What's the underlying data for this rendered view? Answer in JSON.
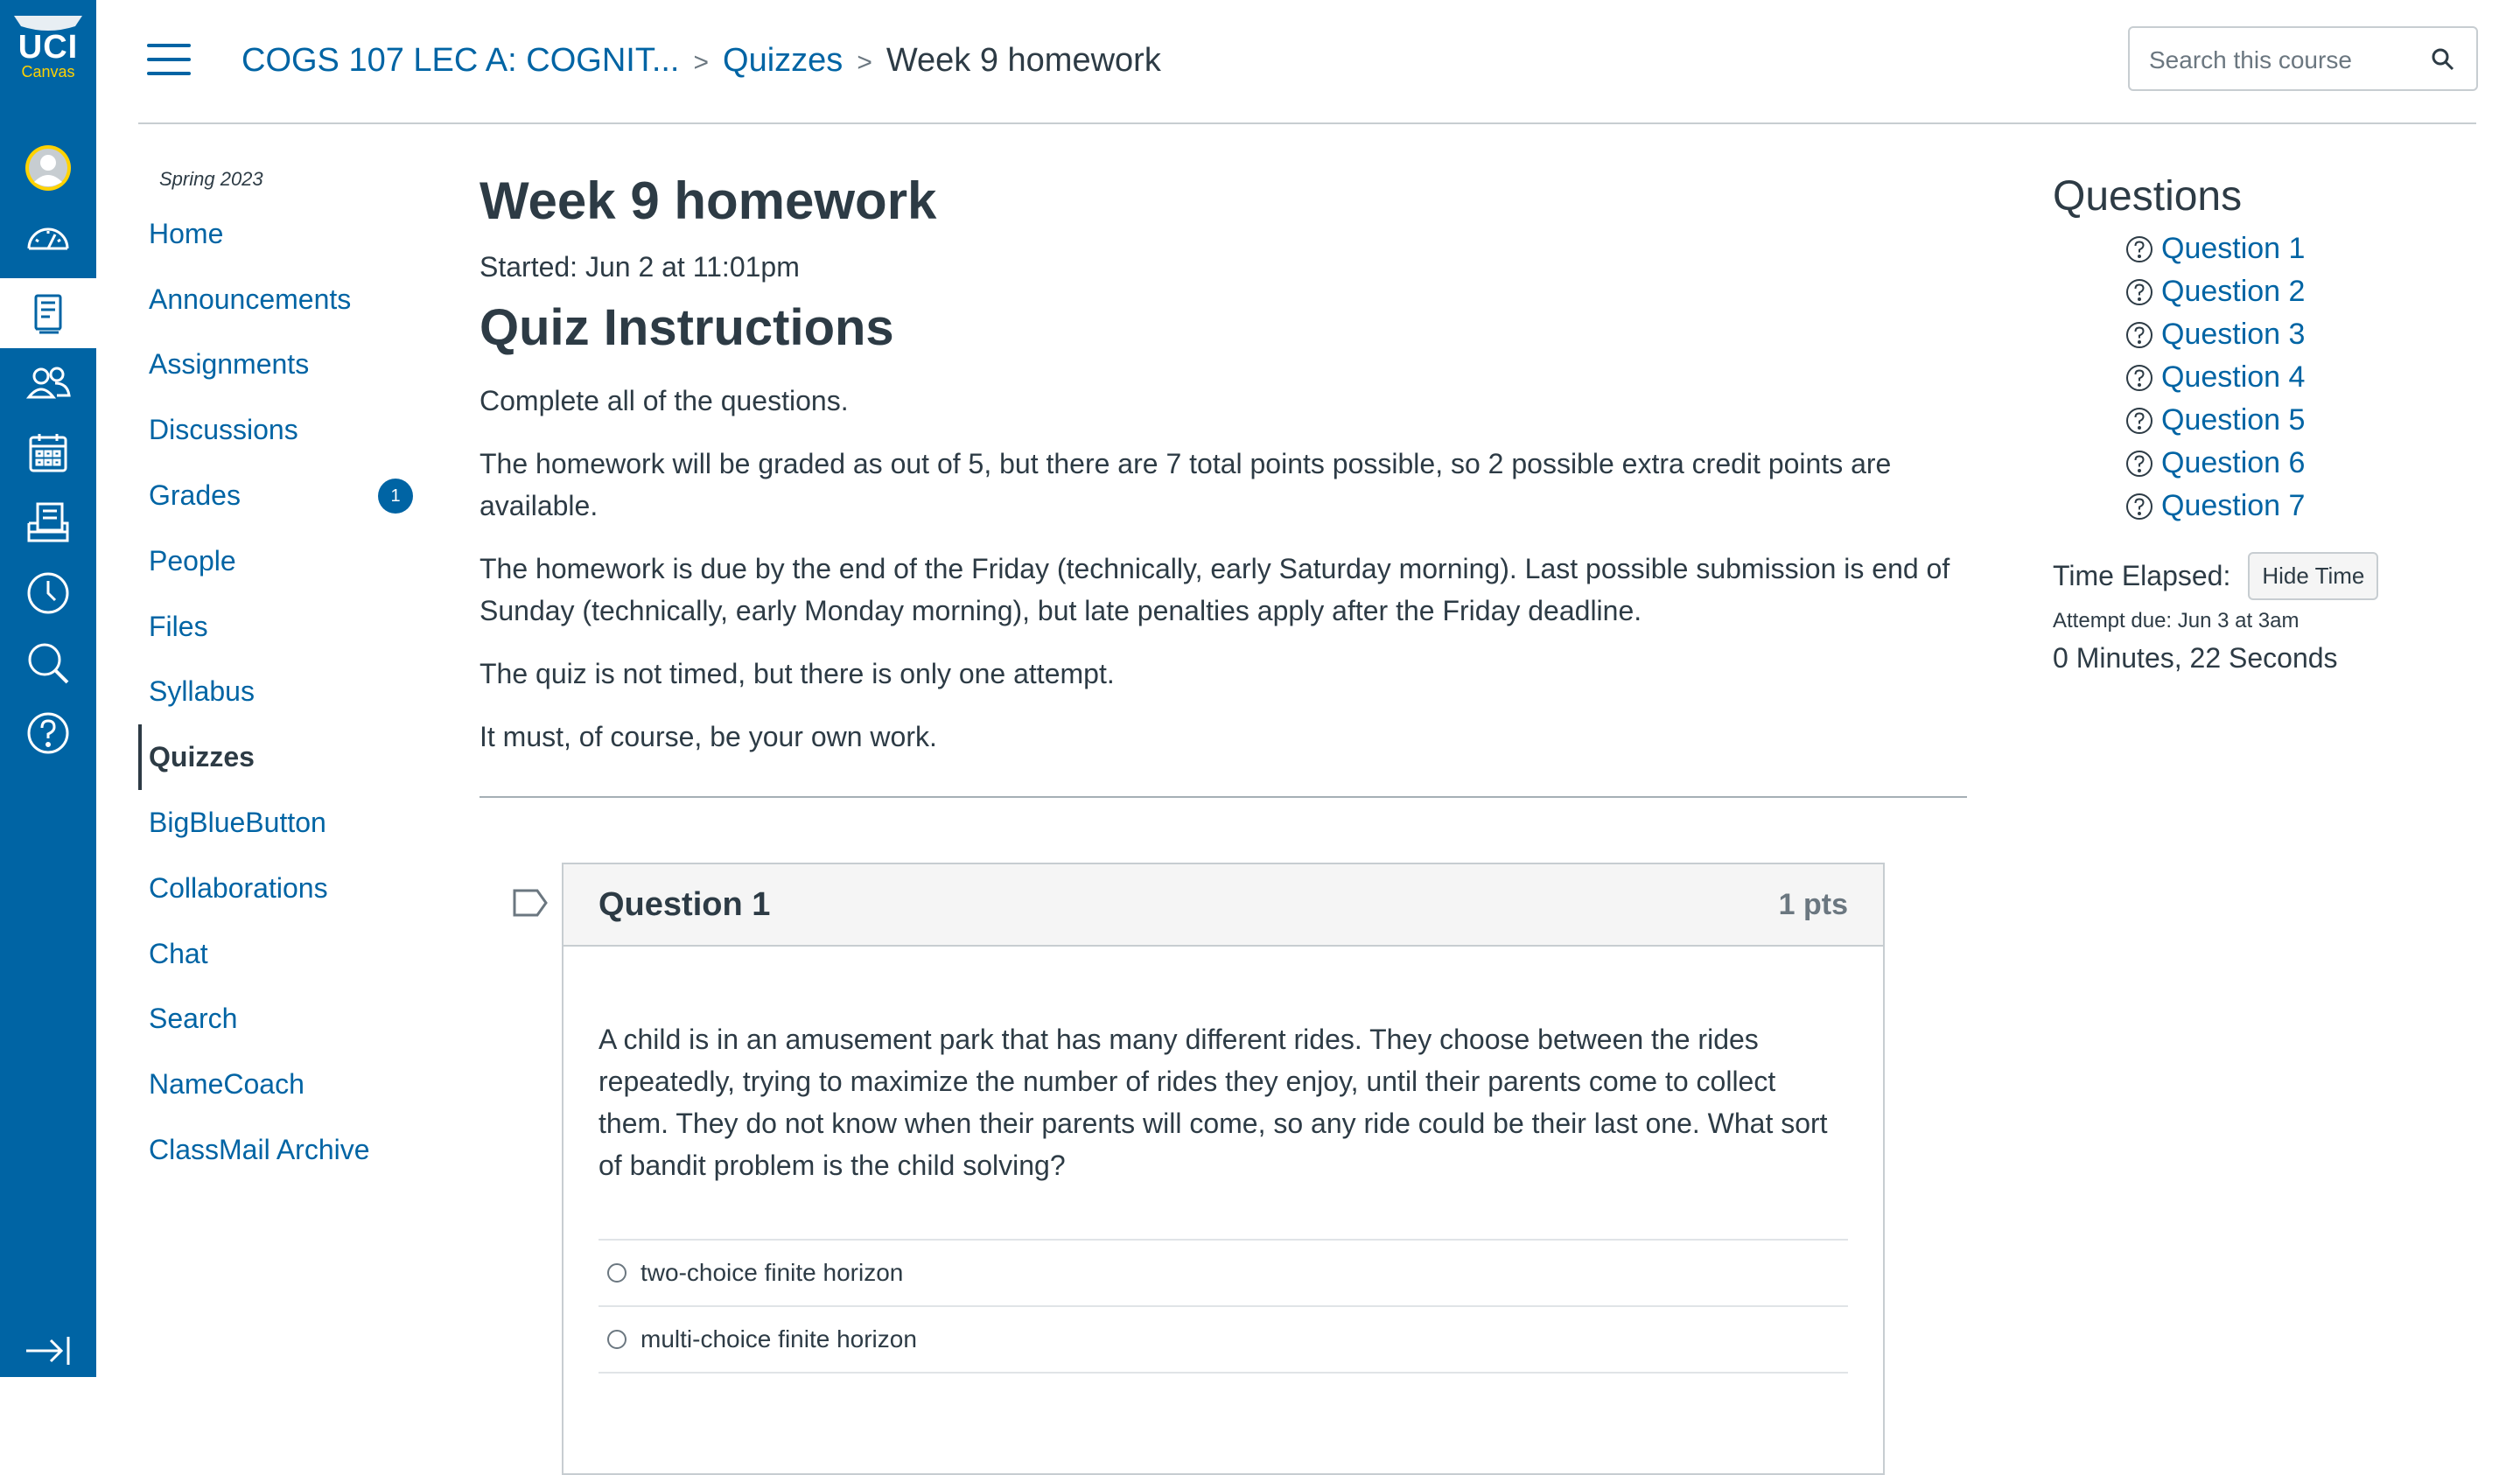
{
  "global_nav": {
    "logo_top": "UCI",
    "logo_bottom": "Canvas",
    "items": [
      "account-icon",
      "dashboard-icon",
      "courses-icon",
      "groups-icon",
      "calendar-icon",
      "inbox-icon",
      "history-icon",
      "search-icon",
      "help-icon"
    ]
  },
  "breadcrumb": {
    "course": "COGS 107 LEC A: COGNIT...",
    "section": "Quizzes",
    "current": "Week 9 homework"
  },
  "search": {
    "placeholder": "Search this course"
  },
  "course_nav": {
    "term": "Spring 2023",
    "items": [
      {
        "label": "Home"
      },
      {
        "label": "Announcements"
      },
      {
        "label": "Assignments"
      },
      {
        "label": "Discussions"
      },
      {
        "label": "Grades",
        "badge": "1"
      },
      {
        "label": "People"
      },
      {
        "label": "Files"
      },
      {
        "label": "Syllabus"
      },
      {
        "label": "Quizzes",
        "active": true
      },
      {
        "label": "BigBlueButton"
      },
      {
        "label": "Collaborations"
      },
      {
        "label": "Chat"
      },
      {
        "label": "Search"
      },
      {
        "label": "NameCoach"
      },
      {
        "label": "ClassMail Archive"
      }
    ]
  },
  "quiz": {
    "title": "Week 9 homework",
    "started": "Started: Jun 2 at 11:01pm",
    "instructions_heading": "Quiz Instructions",
    "instructions": [
      "Complete all of the questions.",
      "The homework will be graded as out of 5, but there are 7 total points possible, so 2 possible extra credit points are available.",
      "The homework is due by the end of the Friday (technically, early Saturday morning). Last possible submission is end of Sunday (technically, early Monday morning), but late penalties apply after the Friday deadline.",
      "The quiz is not timed, but there is only one attempt.",
      "It must, of course, be your own work."
    ]
  },
  "question1": {
    "name": "Question 1",
    "points": "1 pts",
    "text": "A child is in an amusement park that has many different rides. They choose between the rides repeatedly, trying to maximize the number of rides they enjoy, until their parents come to collect them. They do not know when their parents will come, so any ride could be their last one. What sort of bandit problem is the child solving?",
    "answers": [
      "two-choice finite horizon",
      "multi-choice finite horizon"
    ]
  },
  "sidebar": {
    "heading": "Questions",
    "questions": [
      "Question 1",
      "Question 2",
      "Question 3",
      "Question 4",
      "Question 5",
      "Question 6",
      "Question 7"
    ],
    "time_label": "Time Elapsed:",
    "hide_button": "Hide Time",
    "attempt_due": "Attempt due: Jun 3 at 3am",
    "elapsed": "0 Minutes, 22 Seconds"
  }
}
